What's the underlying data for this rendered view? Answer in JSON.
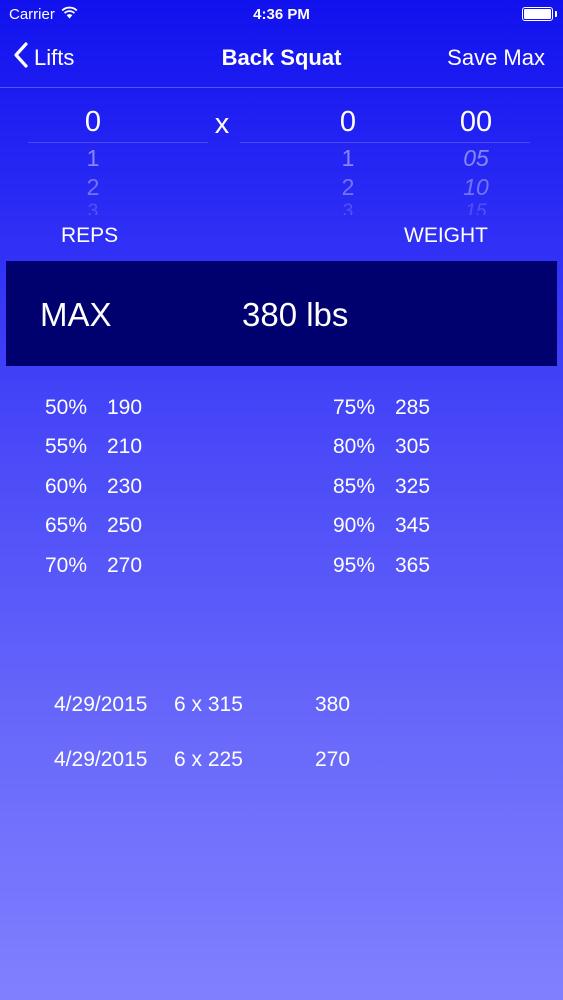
{
  "status": {
    "carrier": "Carrier",
    "time": "4:36 PM"
  },
  "nav": {
    "back_label": "Lifts",
    "title": "Back Squat",
    "save_label": "Save Max"
  },
  "picker": {
    "times_sign": "x",
    "reps": {
      "selected": "0",
      "options": [
        "1",
        "2",
        "3"
      ]
    },
    "weight_whole": {
      "selected": "0",
      "options": [
        "1",
        "2",
        "3"
      ]
    },
    "weight_fraction": {
      "selected": "00",
      "options": [
        "05",
        "10",
        "15"
      ]
    },
    "reps_label": "REPS",
    "weight_label": "WEIGHT"
  },
  "max": {
    "label": "MAX",
    "value": "380 lbs"
  },
  "percentages": {
    "left": [
      {
        "pct": "50%",
        "value": "190"
      },
      {
        "pct": "55%",
        "value": "210"
      },
      {
        "pct": "60%",
        "value": "230"
      },
      {
        "pct": "65%",
        "value": "250"
      },
      {
        "pct": "70%",
        "value": "270"
      }
    ],
    "right": [
      {
        "pct": "75%",
        "value": "285"
      },
      {
        "pct": "80%",
        "value": "305"
      },
      {
        "pct": "85%",
        "value": "325"
      },
      {
        "pct": "90%",
        "value": "345"
      },
      {
        "pct": "95%",
        "value": "365"
      }
    ]
  },
  "history": [
    {
      "date": "4/29/2015",
      "set": "6 x 315",
      "max": "380"
    },
    {
      "date": "4/29/2015",
      "set": "6 x 225",
      "max": "270"
    }
  ],
  "colors": {
    "max_panel": "#00006e",
    "gradient_top": "#1111ee",
    "gradient_bottom": "#8080ff"
  }
}
